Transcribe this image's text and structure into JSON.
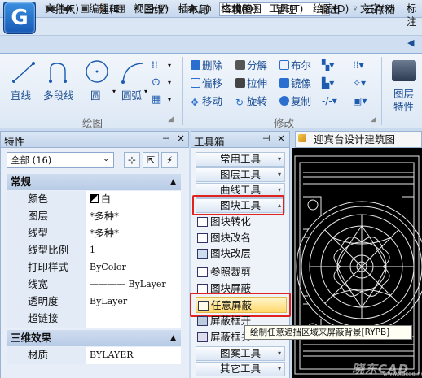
{
  "app": {
    "logo_letter": "G",
    "doc_title": "二维草图"
  },
  "menu": [
    "文件(F)",
    "编辑(E)",
    "视图(V)",
    "插入(I)",
    "格式(O)",
    "工具(T)",
    "绘图(D)",
    "文字(X)",
    "标注"
  ],
  "tabs": [
    "常用",
    "插入",
    "注释",
    "三维",
    "布局",
    "视图",
    "管理",
    "输出",
    "云存储"
  ],
  "ribbon": {
    "draw_group": {
      "label": "绘图",
      "tools": [
        "直线",
        "多段线",
        "圆",
        "圆弧"
      ]
    },
    "modify_group": {
      "label": "修改",
      "col1": [
        "删除",
        "偏移",
        "移动"
      ],
      "col2": [
        "分解",
        "拉伸",
        "旋转"
      ],
      "col3": [
        "布尔",
        "镜像",
        "复制"
      ]
    },
    "layer": {
      "label1": "图层",
      "label2": "特性"
    }
  },
  "properties": {
    "title": "特性",
    "selection": "全部 (16)",
    "sections": [
      {
        "name": "常规",
        "rows": [
          {
            "name": "颜色",
            "value": "白"
          },
          {
            "name": "图层",
            "value": "*多种*"
          },
          {
            "name": "线型",
            "value": "*多种*"
          },
          {
            "name": "线型比例",
            "value": "1"
          },
          {
            "name": "打印样式",
            "value": "ByColor"
          },
          {
            "name": "线宽",
            "value": "———— ByLayer"
          },
          {
            "name": "透明度",
            "value": "ByLayer"
          },
          {
            "name": "超链接",
            "value": ""
          }
        ]
      },
      {
        "name": "三维效果",
        "rows": [
          {
            "name": "材质",
            "value": "BYLAYER"
          }
        ]
      }
    ]
  },
  "toolbox": {
    "title": "工具箱",
    "categories_top": [
      "常用工具",
      "图层工具",
      "曲线工具",
      "图块工具"
    ],
    "items": [
      "图块转化",
      "图块改名",
      "图块改层",
      "参照裁剪",
      "图块屏蔽",
      "任意屏蔽",
      "屏蔽框开",
      "屏蔽框关"
    ],
    "categories_bottom": [
      "图案工具",
      "其它工具"
    ]
  },
  "drawing": {
    "tab_title": "迎宾台设计建筑图"
  },
  "tooltip": "绘制任意遮挡区域来屏蔽背景[RYPB]",
  "watermark": "晓东CAD家园 www.xdcad.net"
}
